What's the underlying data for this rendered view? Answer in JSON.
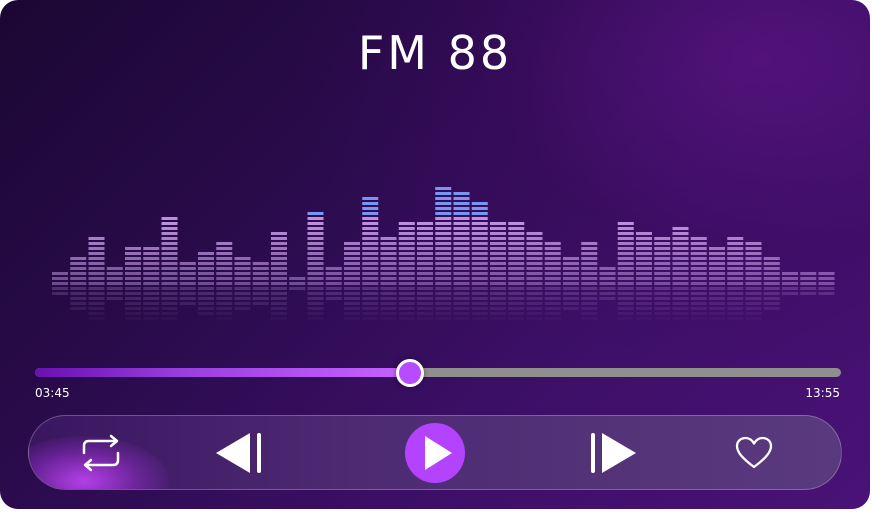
{
  "player": {
    "station_name": "FM 88",
    "time_elapsed": "03:45",
    "time_total": "13:55",
    "progress_fraction": 0.465
  },
  "equalizer": {
    "levels": [
      2,
      5,
      9,
      3,
      7,
      7,
      13,
      4,
      6,
      8,
      5,
      4,
      10,
      1,
      14,
      3,
      8,
      17,
      9,
      12,
      12,
      19,
      18,
      16,
      12,
      12,
      10,
      8,
      5,
      8,
      3,
      12,
      10,
      9,
      11,
      9,
      7,
      9,
      8,
      5,
      2,
      2,
      2
    ],
    "accent_colors": [
      "#7ea0ff",
      "#c79be8"
    ]
  },
  "controls": {
    "repeat_icon": "repeat-icon",
    "previous_icon": "skip-previous-icon",
    "play_icon": "play-icon",
    "next_icon": "skip-next-icon",
    "favorite_icon": "heart-icon",
    "play_color": "#b443ff"
  }
}
